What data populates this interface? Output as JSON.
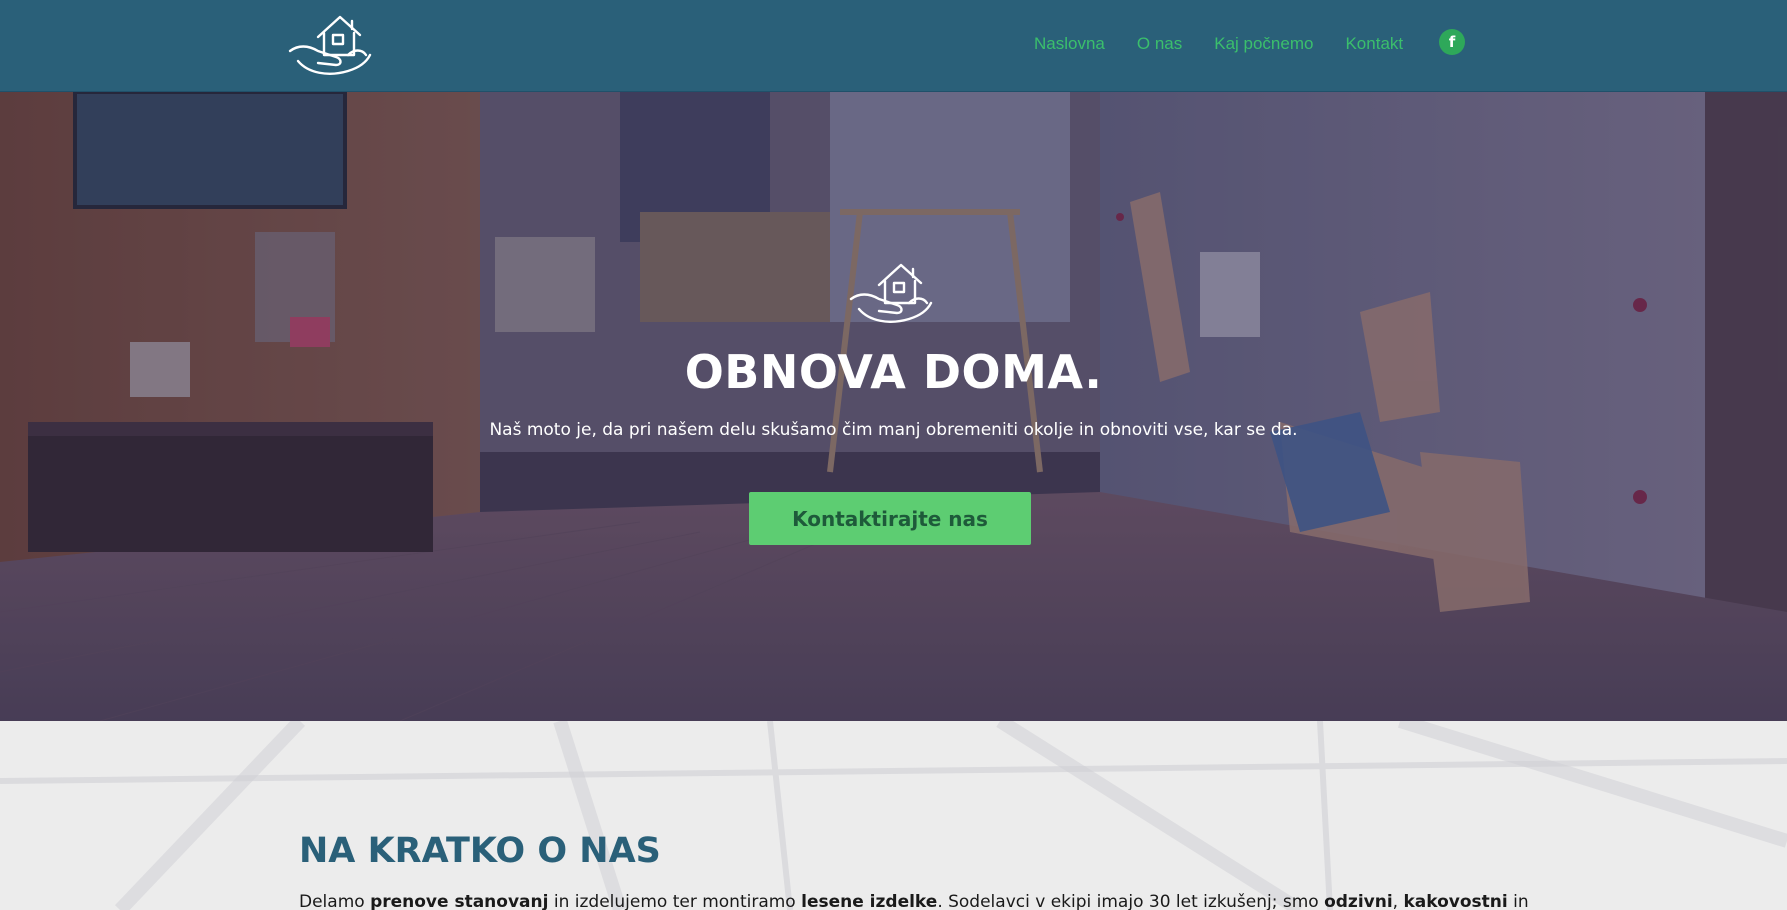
{
  "header": {
    "logo_icon": "house-in-hand-icon",
    "nav": [
      {
        "label": "Naslovna"
      },
      {
        "label": "O nas"
      },
      {
        "label": "Kaj počnemo"
      },
      {
        "label": "Kontakt"
      }
    ],
    "social_icon": "facebook-icon",
    "social_glyph": "f",
    "nav_color": "#3bbf6c",
    "bar_color": "#2a6079"
  },
  "hero": {
    "logo_icon": "house-in-hand-icon",
    "title": "OBNOVA DOMA.",
    "subtitle": "Naš moto je, da pri našem delu skušamo čim manj obremeniti okolje in obnoviti vse, kar se da.",
    "cta_label": "Kontaktirajte nas",
    "cta_color": "#5dcd72"
  },
  "about": {
    "title": "NA KRATKO O NAS",
    "text_parts": [
      {
        "t": "Delamo ",
        "b": false
      },
      {
        "t": "prenove stanovanj",
        "b": true
      },
      {
        "t": " in izdelujemo ter montiramo ",
        "b": false
      },
      {
        "t": "lesene izdelke",
        "b": true
      },
      {
        "t": ". Sodelavci v ekipi imajo 30 let izkušenj; smo ",
        "b": false
      },
      {
        "t": "odzivni",
        "b": true
      },
      {
        "t": ", ",
        "b": false
      },
      {
        "t": "kakovostni",
        "b": true
      },
      {
        "t": " in",
        "b": false
      }
    ],
    "title_color": "#2a6079"
  }
}
